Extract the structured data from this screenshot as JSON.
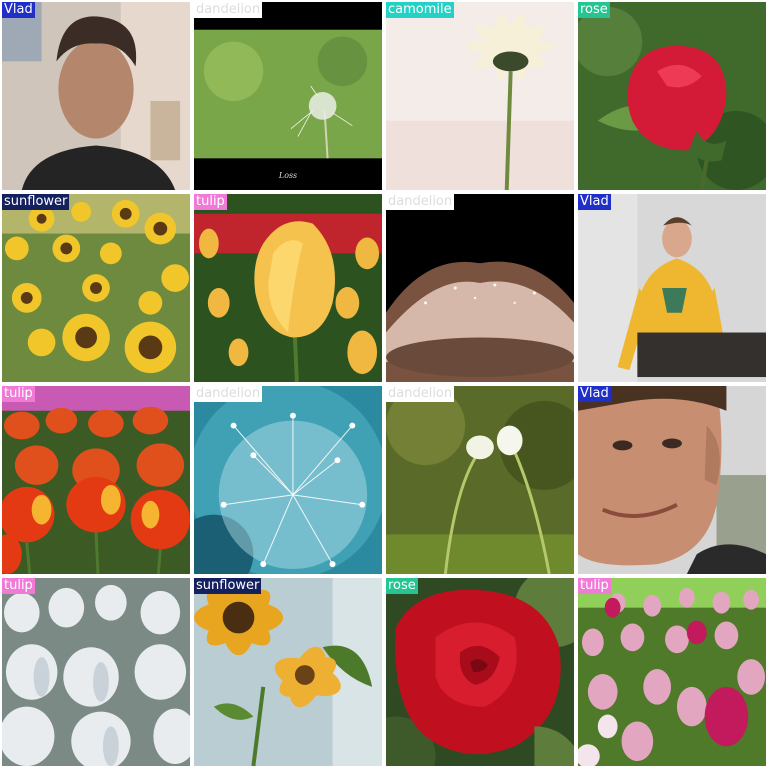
{
  "labels": {
    "vlad": {
      "text": "Vlad",
      "color": "#1f2fc8"
    },
    "dandelion": {
      "text": "dandelion",
      "color": "#ffffff"
    },
    "camomile": {
      "text": "camomile",
      "color": "#25d0c4"
    },
    "rose": {
      "text": "rose",
      "color": "#25c493"
    },
    "sunflower": {
      "text": "sunflower",
      "color": "#14215e"
    },
    "tulip": {
      "text": "tulip",
      "color": "#f07ad6"
    }
  },
  "tiles": [
    {
      "label": "Vlad",
      "scene": "portrait-indoor"
    },
    {
      "label": "dandelion",
      "scene": "dandelion-seedhead-caption",
      "caption": "Loss"
    },
    {
      "label": "camomile",
      "scene": "white-daisy"
    },
    {
      "label": "rose",
      "scene": "red-rose-bud"
    },
    {
      "label": "sunflower",
      "scene": "sunflower-field"
    },
    {
      "label": "tulip",
      "scene": "yellow-tulip-red-field"
    },
    {
      "label": "dandelion",
      "scene": "dandelion-backlit-dark"
    },
    {
      "label": "Vlad",
      "scene": "yellow-hoodie-seated"
    },
    {
      "label": "tulip",
      "scene": "orange-red-tulip-field"
    },
    {
      "label": "dandelion",
      "scene": "blue-dandelion-closeup"
    },
    {
      "label": "dandelion",
      "scene": "dandelion-buds-green"
    },
    {
      "label": "Vlad",
      "scene": "face-closeup"
    },
    {
      "label": "tulip",
      "scene": "white-tulips"
    },
    {
      "label": "sunflower",
      "scene": "sunflowers-window"
    },
    {
      "label": "rose",
      "scene": "red-rose-bloom"
    },
    {
      "label": "tulip",
      "scene": "pink-tulip-field"
    }
  ]
}
